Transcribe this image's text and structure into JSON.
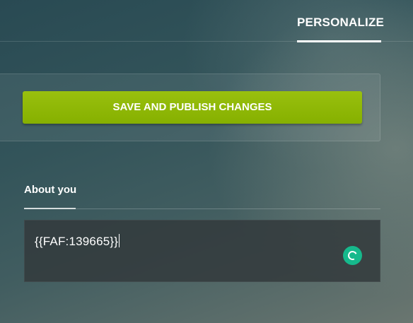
{
  "header": {
    "active_tab_label": "PERSONALIZE"
  },
  "publish": {
    "button_label": "SAVE AND PUBLISH CHANGES",
    "button_color": "#8fb80a"
  },
  "about_section": {
    "title": "About you",
    "field_value": "{{FAF:139665}}",
    "spinner_icon": "loading-spinner-icon",
    "spinner_color": "#16b98c"
  }
}
